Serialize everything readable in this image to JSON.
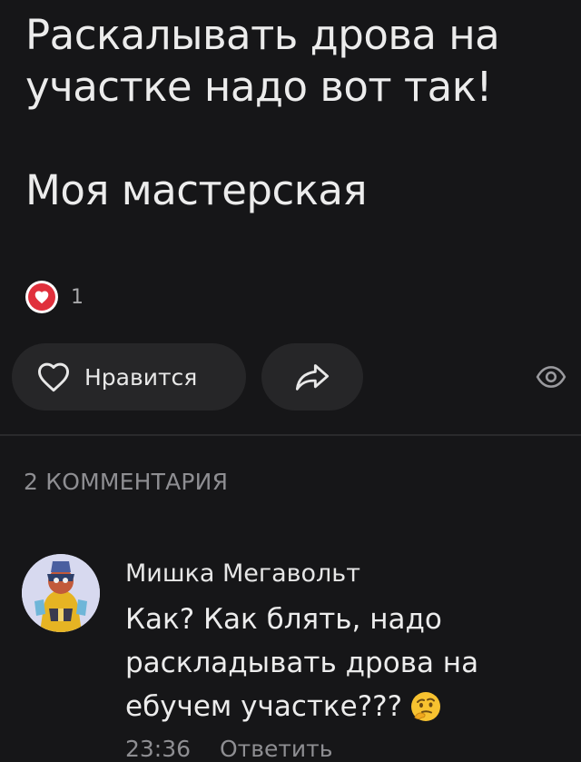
{
  "post": {
    "text_lines": [
      "Раскалывать дрова на",
      "участке надо вот так!"
    ],
    "subtitle": "Моя мастерская"
  },
  "reactions": {
    "count": "1",
    "icon": "heart-icon",
    "color": "#e0303c"
  },
  "actions": {
    "like_label": "Нравится",
    "share_icon": "share-icon",
    "views_icon": "eye-icon"
  },
  "comments": {
    "header": "2 КОММЕНТАРИЯ",
    "items": [
      {
        "author": "Мишка Мегавольт",
        "text_lines": [
          "Как? Как блять, надо",
          "раскладывать дрова на",
          "ебучем  участке???"
        ],
        "emoji": "thinking-face-emoji",
        "time": "23:36",
        "reply_label": "Ответить"
      }
    ]
  }
}
